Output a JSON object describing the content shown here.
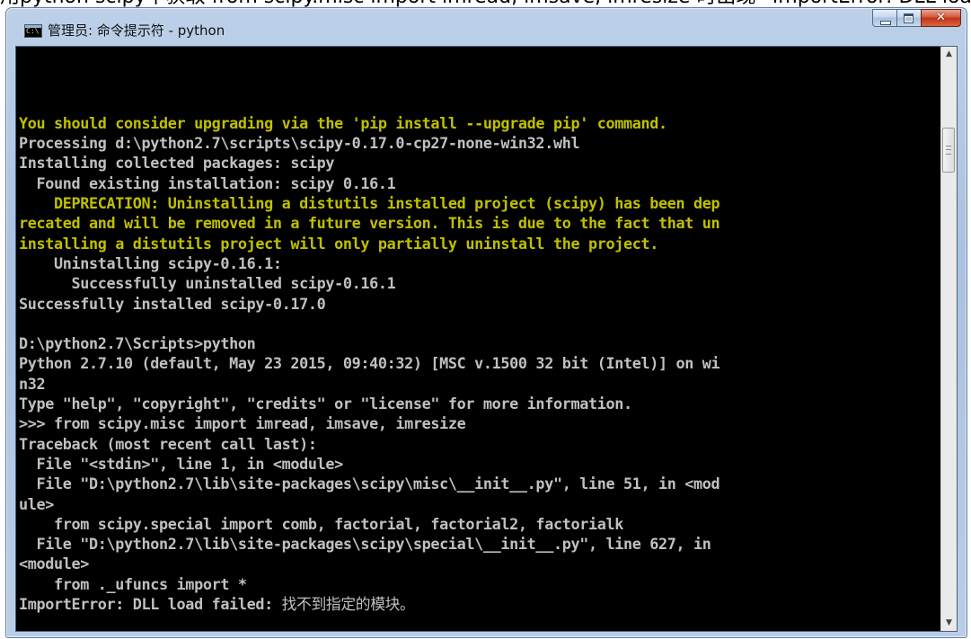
{
  "background_caption": "用python scipy中获取 from scipy.misc import imread, imsave, imresize 时出现 “ImportError: DLL load failed: 找不到指定的模块”",
  "window": {
    "title": "管理员: 命令提示符 - python",
    "icon_text": "C:\\"
  },
  "console": {
    "lines": [
      {
        "text": "You should consider upgrading via the 'pip install --upgrade pip' command.",
        "tone": "warn"
      },
      {
        "text": "Processing d:\\python2.7\\scripts\\scipy-0.17.0-cp27-none-win32.whl",
        "tone": "normal"
      },
      {
        "text": "Installing collected packages: scipy",
        "tone": "normal"
      },
      {
        "text": "  Found existing installation: scipy 0.16.1",
        "tone": "normal"
      },
      {
        "text": "    DEPRECATION: Uninstalling a distutils installed project (scipy) has been dep",
        "tone": "warn"
      },
      {
        "text": "recated and will be removed in a future version. This is due to the fact that un",
        "tone": "warn"
      },
      {
        "text": "installing a distutils project will only partially uninstall the project.",
        "tone": "warn"
      },
      {
        "text": "    Uninstalling scipy-0.16.1:",
        "tone": "normal"
      },
      {
        "text": "      Successfully uninstalled scipy-0.16.1",
        "tone": "normal"
      },
      {
        "text": "Successfully installed scipy-0.17.0",
        "tone": "normal"
      },
      {
        "text": "",
        "tone": "normal"
      },
      {
        "text": "D:\\python2.7\\Scripts>python",
        "tone": "normal"
      },
      {
        "text": "Python 2.7.10 (default, May 23 2015, 09:40:32) [MSC v.1500 32 bit (Intel)] on wi",
        "tone": "normal"
      },
      {
        "text": "n32",
        "tone": "normal"
      },
      {
        "text": "Type \"help\", \"copyright\", \"credits\" or \"license\" for more information.",
        "tone": "normal"
      },
      {
        "text": ">>> from scipy.misc import imread, imsave, imresize",
        "tone": "normal"
      },
      {
        "text": "Traceback (most recent call last):",
        "tone": "normal"
      },
      {
        "text": "  File \"<stdin>\", line 1, in <module>",
        "tone": "normal"
      },
      {
        "text": "  File \"D:\\python2.7\\lib\\site-packages\\scipy\\misc\\__init__.py\", line 51, in <mod",
        "tone": "normal"
      },
      {
        "text": "ule>",
        "tone": "normal"
      },
      {
        "text": "    from scipy.special import comb, factorial, factorial2, factorialk",
        "tone": "normal"
      },
      {
        "text": "  File \"D:\\python2.7\\lib\\site-packages\\scipy\\special\\__init__.py\", line 627, in",
        "tone": "normal"
      },
      {
        "text": "<module>",
        "tone": "normal"
      },
      {
        "text": "    from ._ufuncs import *",
        "tone": "normal"
      }
    ],
    "last_line": {
      "prefix": "ImportError: DLL load failed: ",
      "message": "找不到指定的模块。"
    }
  },
  "colors": {
    "console_bg": "#000000",
    "text_normal": "#c0c0c0",
    "text_warn": "#c0c000",
    "close_button": "#c2331a"
  },
  "icons": [
    "cmd-icon",
    "minimize-icon",
    "maximize-icon",
    "close-icon",
    "scroll-up-icon",
    "scroll-down-icon"
  ]
}
